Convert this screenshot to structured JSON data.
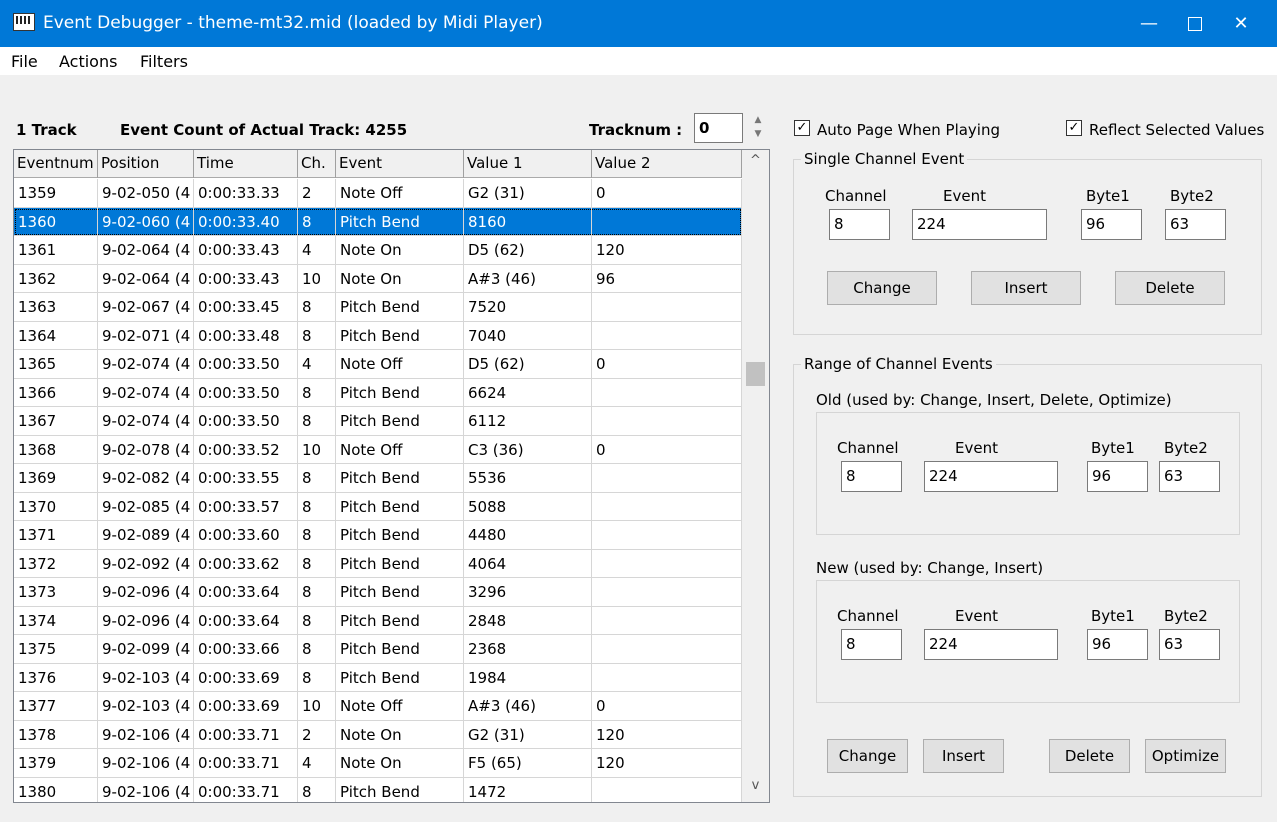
{
  "window": {
    "title": "Event Debugger - theme-mt32.mid (loaded by Midi Player)",
    "minimize": "—",
    "close": "✕"
  },
  "menu": [
    "File",
    "Actions",
    "Filters"
  ],
  "header": {
    "track_label": "1 Track",
    "event_count_label": "Event Count of Actual Track: 4255",
    "tracknum_label": "Tracknum :",
    "tracknum_value": "0"
  },
  "table": {
    "columns": [
      "Eventnum",
      "Position",
      "Time",
      "Ch.",
      "Event",
      "Value 1",
      "Value 2"
    ],
    "selected_row": 1,
    "rows": [
      [
        "1359",
        "9-02-050  (4",
        "0:00:33.33",
        "2",
        "Note Off",
        "G2 (31)",
        "0"
      ],
      [
        "1360",
        "9-02-060  (4",
        "0:00:33.40",
        "8",
        "Pitch Bend",
        "8160",
        ""
      ],
      [
        "1361",
        "9-02-064  (4",
        "0:00:33.43",
        "4",
        "Note On",
        "D5 (62)",
        "120"
      ],
      [
        "1362",
        "9-02-064  (4",
        "0:00:33.43",
        "10",
        "Note On",
        "A#3 (46)",
        "96"
      ],
      [
        "1363",
        "9-02-067  (4",
        "0:00:33.45",
        "8",
        "Pitch Bend",
        "7520",
        ""
      ],
      [
        "1364",
        "9-02-071  (4",
        "0:00:33.48",
        "8",
        "Pitch Bend",
        "7040",
        ""
      ],
      [
        "1365",
        "9-02-074  (4",
        "0:00:33.50",
        "4",
        "Note Off",
        "D5 (62)",
        "0"
      ],
      [
        "1366",
        "9-02-074  (4",
        "0:00:33.50",
        "8",
        "Pitch Bend",
        "6624",
        ""
      ],
      [
        "1367",
        "9-02-074  (4",
        "0:00:33.50",
        "8",
        "Pitch Bend",
        "6112",
        ""
      ],
      [
        "1368",
        "9-02-078  (4",
        "0:00:33.52",
        "10",
        "Note Off",
        "C3 (36)",
        "0"
      ],
      [
        "1369",
        "9-02-082  (4",
        "0:00:33.55",
        "8",
        "Pitch Bend",
        "5536",
        ""
      ],
      [
        "1370",
        "9-02-085  (4",
        "0:00:33.57",
        "8",
        "Pitch Bend",
        "5088",
        ""
      ],
      [
        "1371",
        "9-02-089  (4",
        "0:00:33.60",
        "8",
        "Pitch Bend",
        "4480",
        ""
      ],
      [
        "1372",
        "9-02-092  (4",
        "0:00:33.62",
        "8",
        "Pitch Bend",
        "4064",
        ""
      ],
      [
        "1373",
        "9-02-096  (4",
        "0:00:33.64",
        "8",
        "Pitch Bend",
        "3296",
        ""
      ],
      [
        "1374",
        "9-02-096  (4",
        "0:00:33.64",
        "8",
        "Pitch Bend",
        "2848",
        ""
      ],
      [
        "1375",
        "9-02-099  (4",
        "0:00:33.66",
        "8",
        "Pitch Bend",
        "2368",
        ""
      ],
      [
        "1376",
        "9-02-103  (4",
        "0:00:33.69",
        "8",
        "Pitch Bend",
        "1984",
        ""
      ],
      [
        "1377",
        "9-02-103  (4",
        "0:00:33.69",
        "10",
        "Note Off",
        "A#3 (46)",
        "0"
      ],
      [
        "1378",
        "9-02-106  (4",
        "0:00:33.71",
        "2",
        "Note On",
        "G2 (31)",
        "120"
      ],
      [
        "1379",
        "9-02-106  (4",
        "0:00:33.71",
        "4",
        "Note On",
        "F5 (65)",
        "120"
      ],
      [
        "1380",
        "9-02-106  (4",
        "0:00:33.71",
        "8",
        "Pitch Bend",
        "1472",
        ""
      ]
    ]
  },
  "options": {
    "auto_page": {
      "label": "Auto Page When Playing",
      "checked": true
    },
    "reflect_values": {
      "label": "Reflect Selected Values",
      "checked": true
    }
  },
  "single": {
    "title": "Single Channel Event",
    "labels": {
      "channel": "Channel",
      "event": "Event",
      "byte1": "Byte1",
      "byte2": "Byte2"
    },
    "values": {
      "channel": "8",
      "event": "224",
      "byte1": "96",
      "byte2": "63"
    },
    "buttons": {
      "change": "Change",
      "insert": "Insert",
      "delete": "Delete"
    }
  },
  "range": {
    "title": "Range of Channel Events",
    "old": {
      "title": "Old  (used by: Change, Insert, Delete, Optimize)",
      "labels": {
        "channel": "Channel",
        "event": "Event",
        "byte1": "Byte1",
        "byte2": "Byte2"
      },
      "values": {
        "channel": "8",
        "event": "224",
        "byte1": "96",
        "byte2": "63"
      }
    },
    "new": {
      "title": "New  (used by: Change, Insert)",
      "labels": {
        "channel": "Channel",
        "event": "Event",
        "byte1": "Byte1",
        "byte2": "Byte2"
      },
      "values": {
        "channel": "8",
        "event": "224",
        "byte1": "96",
        "byte2": "63"
      }
    },
    "buttons": {
      "change": "Change",
      "insert": "Insert",
      "delete": "Delete",
      "optimize": "Optimize"
    }
  },
  "icons": {
    "app": "piano-keyboard-icon",
    "check": "✓",
    "scroll_up": "^",
    "scroll_down": "v",
    "spin_up": "▲",
    "spin_down": "▼"
  }
}
